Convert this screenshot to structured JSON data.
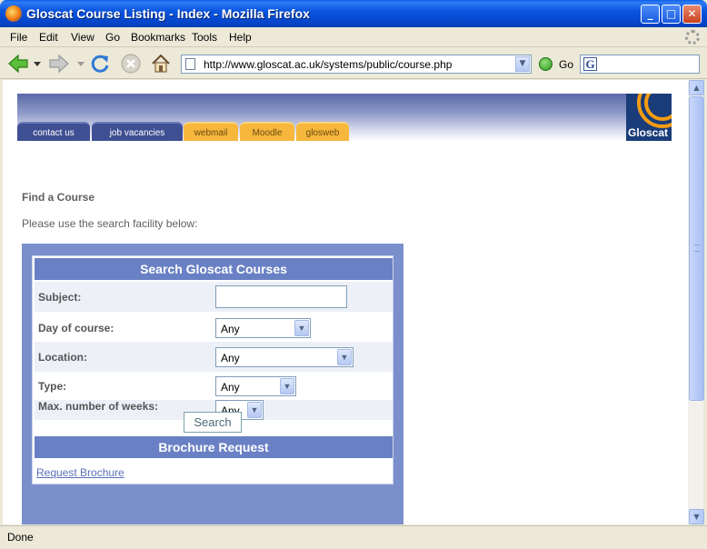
{
  "window": {
    "title": "Gloscat Course Listing - Index - Mozilla Firefox"
  },
  "menubar": {
    "items": [
      "File",
      "Edit",
      "View",
      "Go",
      "Bookmarks",
      "Tools",
      "Help"
    ]
  },
  "toolbar": {
    "url": "http://www.gloscat.ac.uk/systems/public/course.php",
    "go_label": "Go"
  },
  "status": {
    "text": "Done"
  },
  "site": {
    "logo_text": "Gloscat",
    "nav_tabs": [
      "contact us",
      "job vacancies",
      "webmail",
      "Moodle",
      "glosweb"
    ]
  },
  "page": {
    "heading": "Find a Course",
    "instructions": "Please use the search facility below:"
  },
  "search_form": {
    "title": "Search Gloscat Courses",
    "fields": [
      {
        "label": "Subject:",
        "value": ""
      },
      {
        "label": "Day of course:",
        "value": "Any"
      },
      {
        "label": "Location:",
        "value": "Any"
      },
      {
        "label": "Type:",
        "value": "Any"
      },
      {
        "label": "Max. number of weeks:",
        "value": "Any"
      }
    ],
    "button_label": "Search"
  },
  "brochure": {
    "title": "Brochure Request",
    "link_label": "Request Brochure"
  },
  "colors": {
    "panel": "#7a8fcc",
    "section_head": "#6a80c4",
    "nav_blue": "#3f4f93",
    "nav_orange": "#f6b73c"
  }
}
